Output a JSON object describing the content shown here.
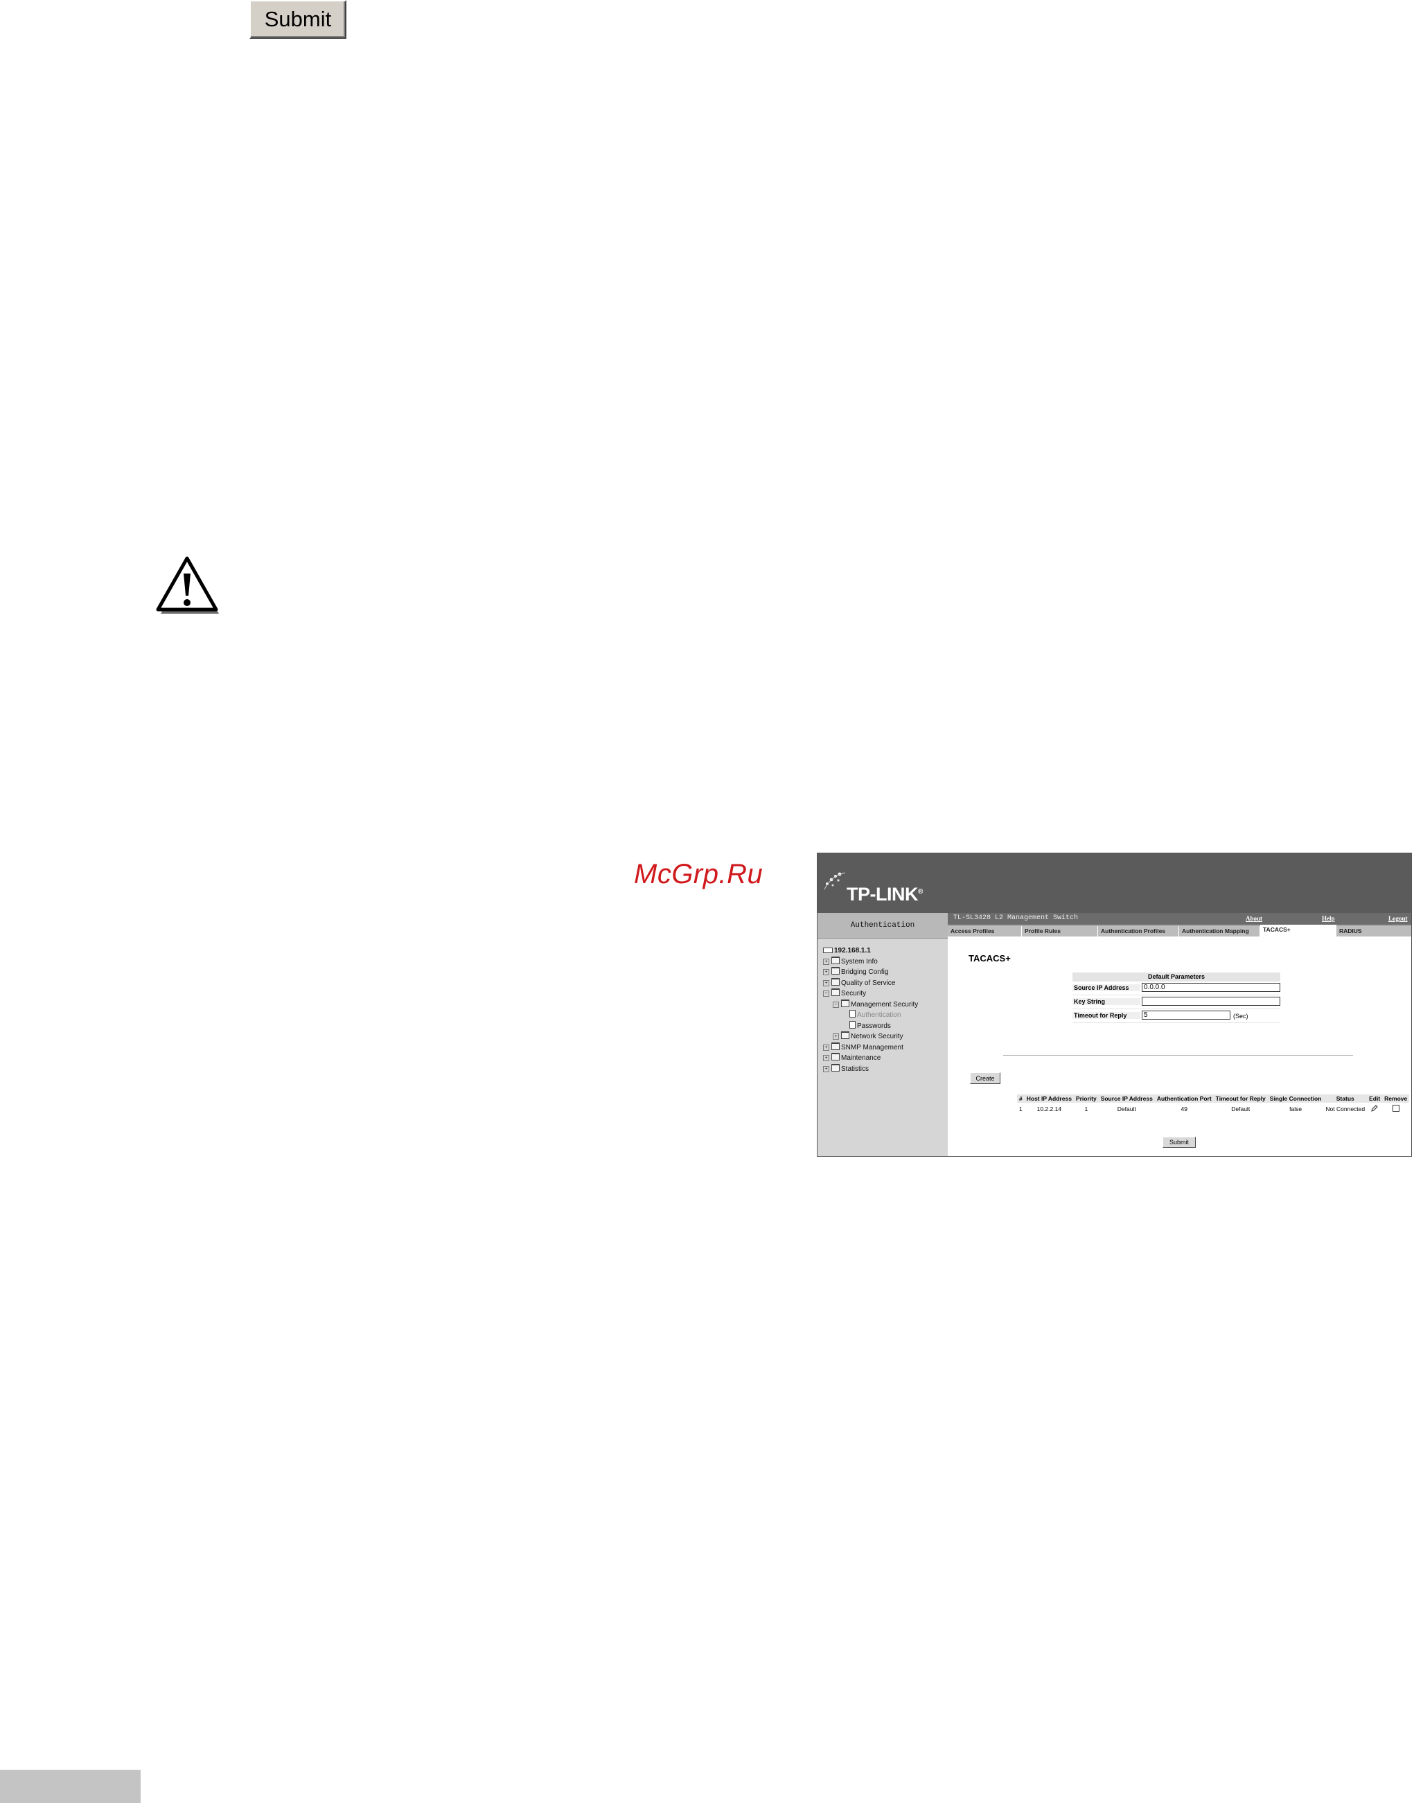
{
  "top_button": {
    "label": "Submit"
  },
  "watermark": "McGrp.Ru",
  "screenshot": {
    "logo": "TP-LINK",
    "logo_mark": "®",
    "left_title": "Authentication",
    "model": "TL-SL3428 L2 Management Switch",
    "top_links": {
      "about": "About",
      "help": "Help",
      "logout": "Logout"
    },
    "tabs": [
      "Access Profiles",
      "Profile Rules",
      "Authentication Profiles",
      "Authentication Mapping",
      "TACACS+",
      "RADIUS"
    ],
    "active_tab": "TACACS+",
    "tree": {
      "root": "192.168.1.1",
      "system_info": "System Info",
      "bridging_config": "Bridging Config",
      "quality_of_service": "Quality of Service",
      "security": "Security",
      "management_security": "Management Security",
      "authentication": "Authentication",
      "passwords": "Passwords",
      "network_security": "Network Security",
      "snmp_management": "SNMP Management",
      "maintenance": "Maintenance",
      "statistics": "Statistics"
    },
    "page_title": "TACACS+",
    "default_parameters": {
      "header": "Default Parameters",
      "source_ip_label": "Source IP Address",
      "source_ip_value": "0.0.0.0",
      "key_string_label": "Key String",
      "key_string_value": "",
      "timeout_label": "Timeout for Reply",
      "timeout_value": "5",
      "timeout_unit": "(Sec)"
    },
    "create_button": "Create",
    "table": {
      "headers": [
        "#",
        "Host IP Address",
        "Priority",
        "Source IP Address",
        "Authentication Port",
        "Timeout for Reply",
        "Single Connection",
        "Status",
        "Edit",
        "Remove"
      ],
      "rows": [
        {
          "num": "1",
          "host": "10.2.2.14",
          "priority": "1",
          "source": "Default",
          "port": "49",
          "timeout": "Default",
          "single": "false",
          "status": "Not Connected"
        }
      ]
    },
    "submit_button": "Submit"
  }
}
